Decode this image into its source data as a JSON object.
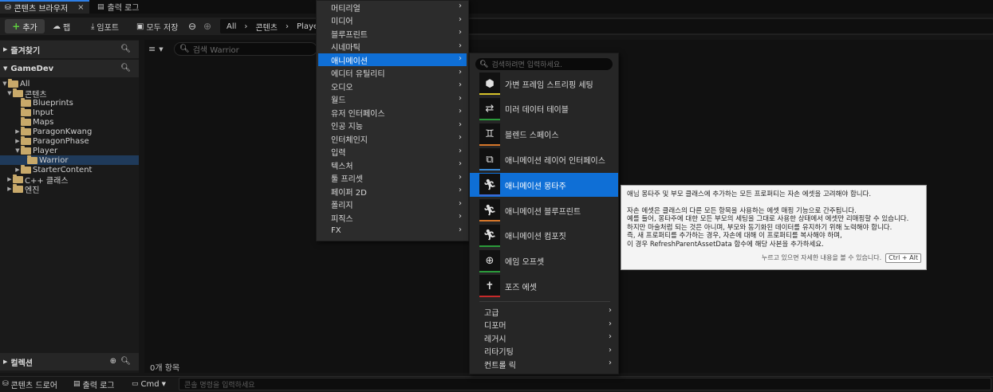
{
  "tabs": {
    "content_browser": "콘텐츠 브라우저",
    "close": "×",
    "output_log": "출력 로그"
  },
  "toolbar": {
    "add": "추가",
    "fab": "팹",
    "import": "임포트",
    "save_all": "모두 저장",
    "path": [
      "All",
      "콘텐츠",
      "Playe"
    ]
  },
  "left_panel": {
    "favorites": "즐겨찾기",
    "project": "GameDev",
    "collections": "컬렉션",
    "tree": [
      {
        "label": "All"
      },
      {
        "label": "콘텐츠"
      },
      {
        "label": "Blueprints"
      },
      {
        "label": "Input"
      },
      {
        "label": "Maps"
      },
      {
        "label": "ParagonKwang"
      },
      {
        "label": "ParagonPhase"
      },
      {
        "label": "Player"
      },
      {
        "label": "Warrior"
      },
      {
        "label": "StarterContent"
      },
      {
        "label": "C++ 클래스"
      },
      {
        "label": "엔진"
      }
    ]
  },
  "center": {
    "search_placeholder": "검색 Warrior",
    "item_count": "0개 항목"
  },
  "bottom": {
    "content_drawer": "콘텐츠 드로어",
    "output_log": "출력 로그",
    "cmd": "Cmd",
    "console_placeholder": "콘솔 명령을 입력하세요"
  },
  "category_menu": [
    "머티리얼",
    "미디어",
    "블루프린트",
    "시네마틱",
    "애니메이션",
    "에디터 유틸리티",
    "오디오",
    "월드",
    "유저 인터페이스",
    "인공 지능",
    "인터체인지",
    "입력",
    "텍스처",
    "툴 프리셋",
    "페이퍼 2D",
    "폴리지",
    "피직스",
    "FX"
  ],
  "highlighted_category": "애니메이션",
  "animation_menu": {
    "search_placeholder": "검색하려면 입력하세요.",
    "assets": [
      {
        "label": "가변 프레임 스트리핑 세팅",
        "icon": "cube-icon",
        "color": "#d6c22a"
      },
      {
        "label": "미러 데이터 테이블",
        "icon": "mirror-figure-icon",
        "color": "#2a9a3a"
      },
      {
        "label": "블렌드 스페이스",
        "icon": "blend-figures-icon",
        "color": "#d6762a"
      },
      {
        "label": "애니메이션 레이어 인터페이스",
        "icon": "layer-nodes-icon",
        "color": "#3a8ad6"
      },
      {
        "label": "애니메이션 몽타주",
        "icon": "montage-runner-icon",
        "color": "#3a6ad6"
      },
      {
        "label": "애니메이션 블루프린트",
        "icon": "runner-blueprint-icon",
        "color": "#d6762a"
      },
      {
        "label": "애니메이션 컴포짓",
        "icon": "runner-composite-icon",
        "color": "#2a9a3a"
      },
      {
        "label": "에임 오프셋",
        "icon": "crosshair-icon",
        "color": "#2a9a3a"
      },
      {
        "label": "포즈 에셋",
        "icon": "pose-figure-icon",
        "color": "#c62a2a"
      }
    ],
    "submenus": [
      "고급",
      "디포머",
      "레거시",
      "리타기팅",
      "컨트롤 릭"
    ]
  },
  "tooltip": {
    "lines": [
      "애님 몽타주 및 부모 클래스에 추가하는 모든 프로퍼티는 자손 에셋을 고려해야 합니다.",
      "",
      "자손 에셋은 클래스의 다른 모든 항목을 사용하는 에셋 매핑 기능으로 간주됩니다.",
      "예를 들어, 몽타주에 대한 모든 부모의 세팅을 그대로 사용한 상태에서 에셋만 리매핑할 수 있습니다.",
      "하지만 마술처럼 되는 것은 아니며, 부모와 동기화된 데이터를 유지하기 위해 노력해야 합니다.",
      "즉, 새 프로퍼티를 추가하는 경우, 자손에 대해 이 프로퍼티를 복사해야 하며,",
      "이 경우 RefreshParentAssetData 함수에 해당 사본을 추가하세요."
    ],
    "hint": "누르고 있으면 자세한 내용을 볼 수 있습니다.",
    "shortcut": "Ctrl + Alt"
  },
  "accent_color": "#0f6fd6"
}
